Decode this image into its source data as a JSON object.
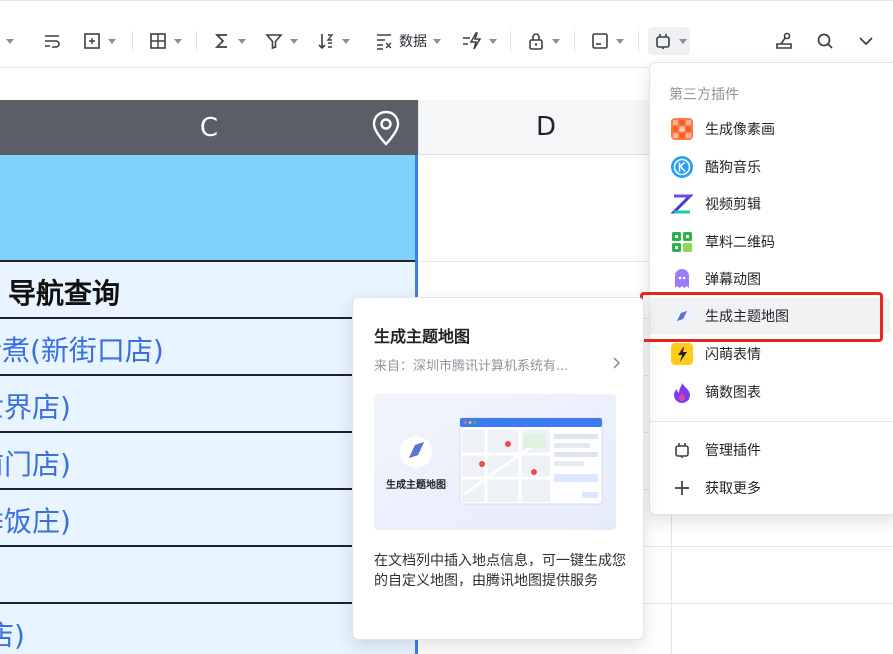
{
  "toolbar": {
    "data_label": "数据"
  },
  "grid": {
    "col_c": "C",
    "col_d": "D",
    "rows": [
      "导航查询",
      "请煮(新街口店)",
      "世界店)",
      "前门店)",
      "季饭庄)",
      "店)"
    ]
  },
  "dropdown": {
    "section_title": "第三方插件",
    "items": [
      {
        "label": "生成像素画",
        "icon": "pixel-art-icon"
      },
      {
        "label": "酷狗音乐",
        "icon": "kugou-music-icon"
      },
      {
        "label": "视频剪辑",
        "icon": "video-edit-icon"
      },
      {
        "label": "草料二维码",
        "icon": "qr-code-icon"
      },
      {
        "label": "弹幕动图",
        "icon": "danmaku-gif-icon"
      },
      {
        "label": "生成主题地图",
        "icon": "theme-map-icon"
      },
      {
        "label": "闪萌表情",
        "icon": "emoji-sticker-icon"
      },
      {
        "label": "镝数图表",
        "icon": "dishu-chart-icon"
      }
    ],
    "manage": {
      "label": "管理插件",
      "icon": "plugin-manage-icon"
    },
    "more": {
      "label": "获取更多",
      "icon": "plus-icon"
    }
  },
  "card": {
    "title": "生成主题地图",
    "source": "来自：深圳市腾讯计算机系统有...",
    "preview_caption": "生成主题地图",
    "description": "在文档列中插入地点信息，可一键生成您的自定义地图，由腾讯地图提供服务"
  },
  "colors": {
    "accent_blue": "#3d7bf0",
    "header_fill": "#7fd2fb",
    "highlight_red": "#e8261e"
  }
}
